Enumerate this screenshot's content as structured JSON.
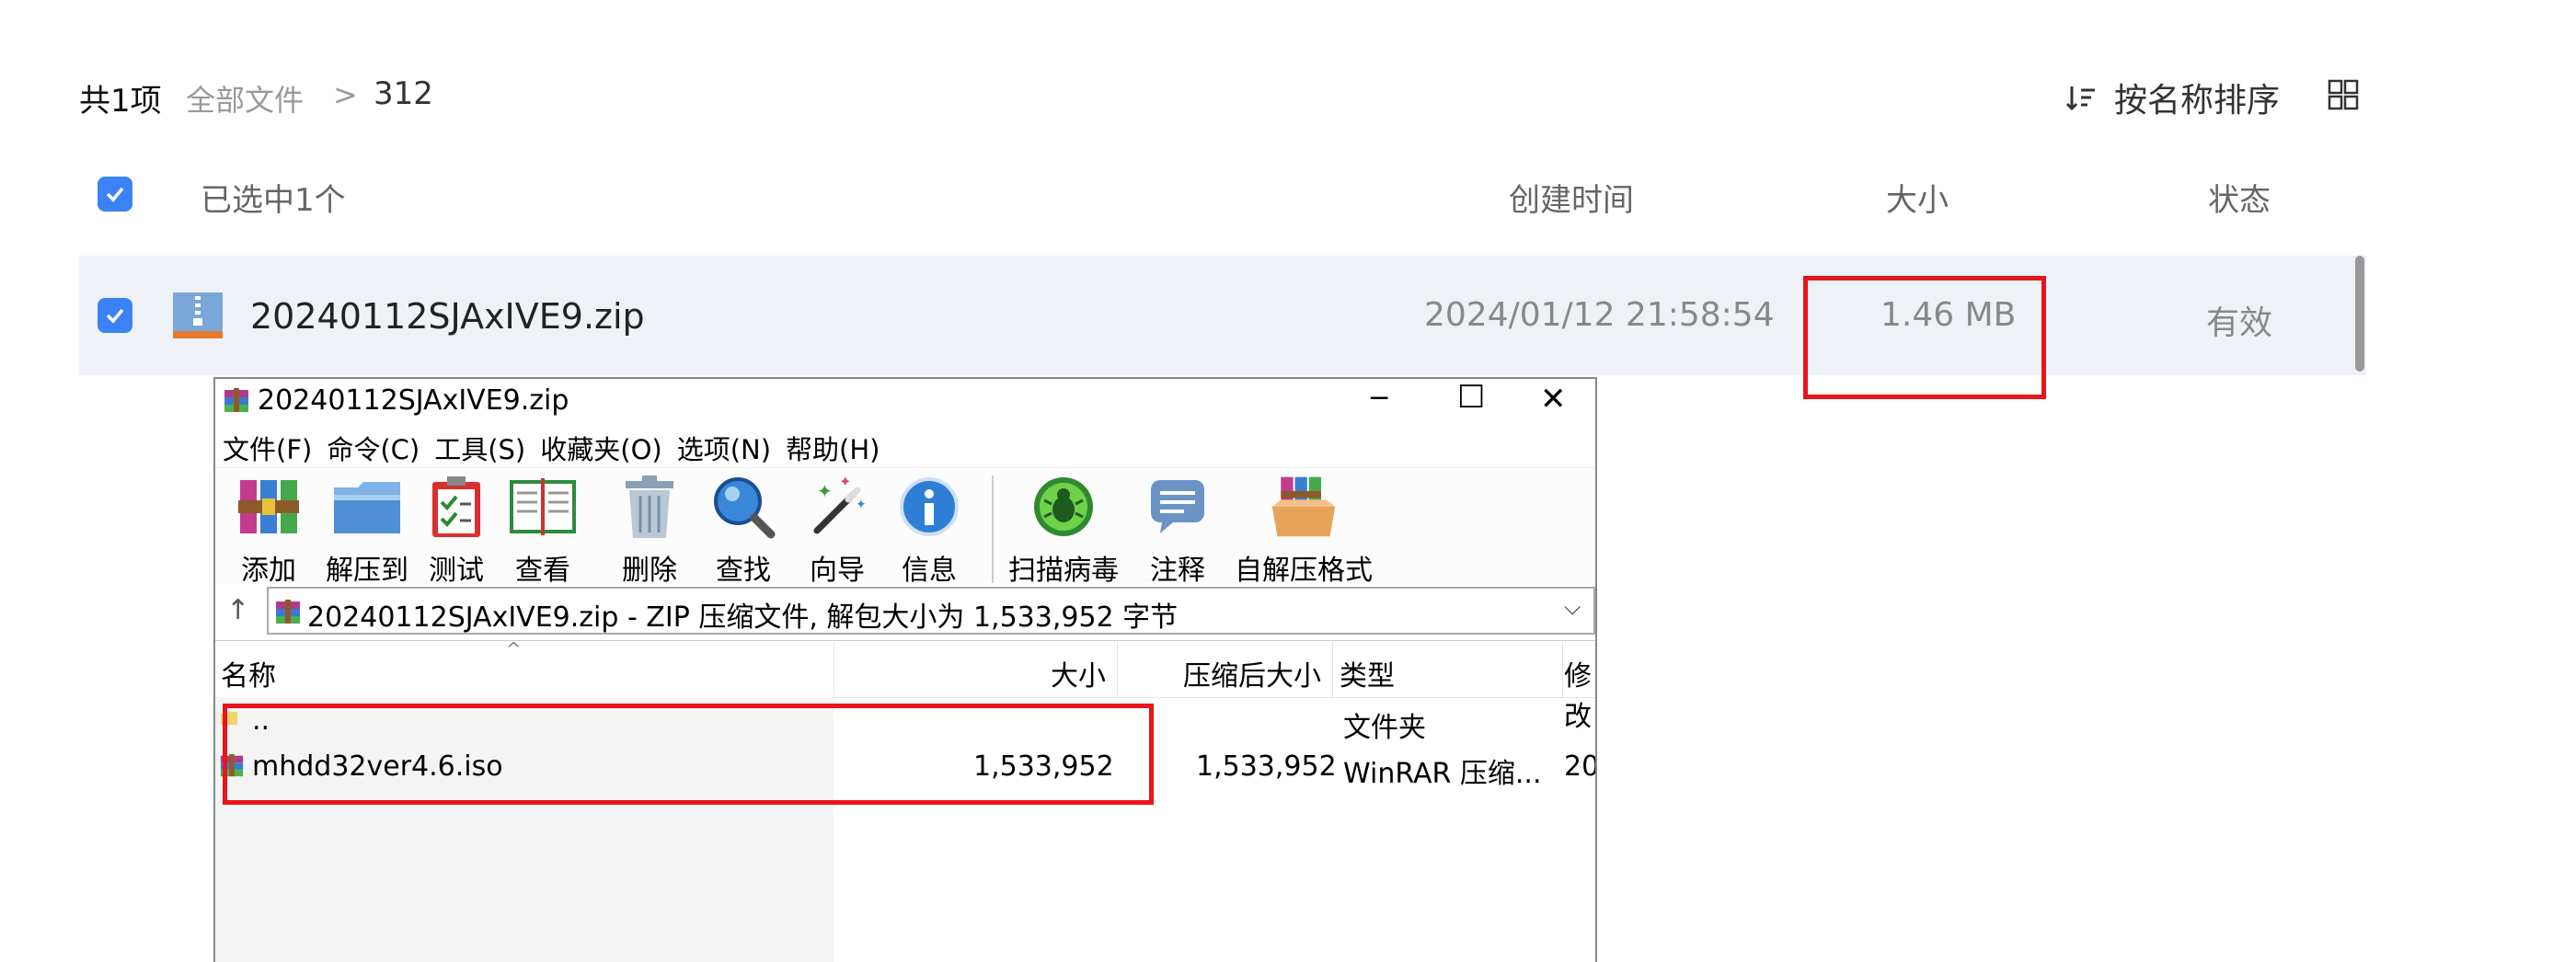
{
  "header": {
    "count": "共1项",
    "breadcrumb_root": "全部文件",
    "breadcrumb_sep": ">",
    "breadcrumb_current": "312",
    "sort_label": "按名称排序"
  },
  "columns": {
    "selected": "已选中1个",
    "created": "创建时间",
    "size": "大小",
    "status": "状态"
  },
  "file_row": {
    "name": "20240112SJAxIVE9.zip",
    "date": "2024/01/12 21:58:54",
    "size": "1.46 MB",
    "status": "有效"
  },
  "winrar": {
    "title": "20240112SJAxIVE9.zip",
    "menu": [
      "文件(F)",
      "命令(C)",
      "工具(S)",
      "收藏夹(O)",
      "选项(N)",
      "帮助(H)"
    ],
    "toolbar": [
      "添加",
      "解压到",
      "测试",
      "查看",
      "删除",
      "查找",
      "向导",
      "信息",
      "扫描病毒",
      "注释",
      "自解压格式"
    ],
    "address": "20240112SJAxIVE9.zip - ZIP 压缩文件, 解包大小为 1,533,952 字节",
    "columns": {
      "name": "名称",
      "size": "大小",
      "packed": "压缩后大小",
      "type": "类型",
      "modified": "修改"
    },
    "rows": [
      {
        "name": "..",
        "size": "",
        "packed": "",
        "type": "文件夹",
        "modified": ""
      },
      {
        "name": "mhdd32ver4.6.iso",
        "size": "1,533,952",
        "packed": "1,533,952",
        "type": "WinRAR 压缩...",
        "modified": "20"
      }
    ]
  },
  "colors": {
    "accent": "#3b82f6",
    "highlight": "#e8151b",
    "row_bg": "#eef2f7"
  }
}
